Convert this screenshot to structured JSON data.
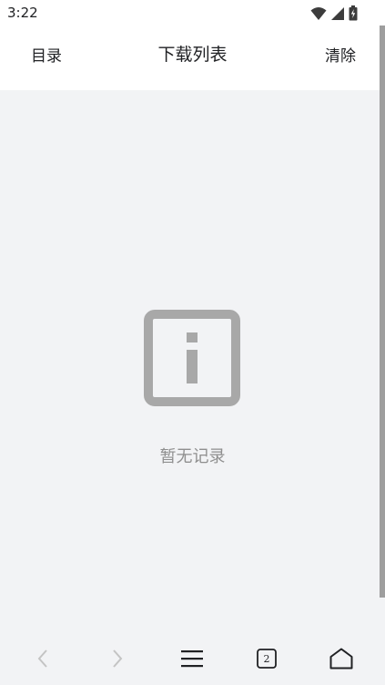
{
  "status_bar": {
    "time": "3:22",
    "icons": [
      "wifi-icon",
      "signal-icon",
      "battery-charging-icon"
    ]
  },
  "header": {
    "left_label": "目录",
    "title": "下载列表",
    "right_label": "清除"
  },
  "empty_state": {
    "icon": "info-icon",
    "message": "暂无记录"
  },
  "bottom_bar": {
    "tab_count": "2",
    "buttons": [
      "back-icon",
      "forward-icon",
      "menu-icon",
      "tabs-icon",
      "home-icon"
    ]
  },
  "colors": {
    "background": "#f2f3f5",
    "header_bg": "#ffffff",
    "icon_gray": "#a8a8a8",
    "text_gray": "#8f8f8f",
    "disabled_gray": "#c4c4c4"
  }
}
